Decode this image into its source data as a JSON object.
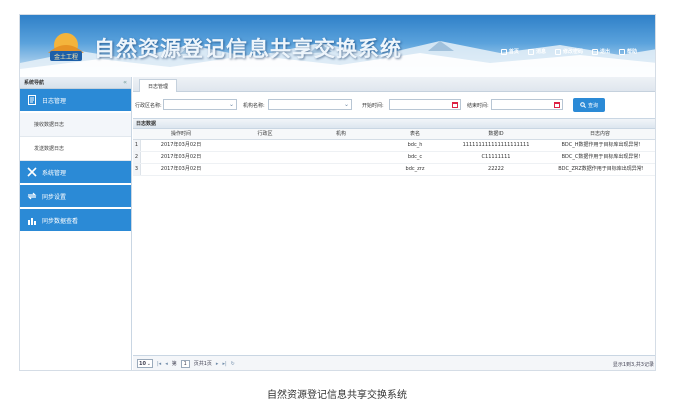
{
  "header": {
    "title": "自然资源登记信息共享交换系统",
    "logo_text": "金土工程",
    "nav": [
      "首页",
      "消息",
      "修改密码",
      "退出",
      "帮助"
    ]
  },
  "sidebar": {
    "title": "系统导航",
    "collapse_glyph": "«",
    "menus": [
      {
        "label": "日志管理",
        "icon": "log-icon"
      },
      {
        "label": "系统管理",
        "icon": "tools-icon"
      },
      {
        "label": "同步设置",
        "icon": "sync-icon"
      },
      {
        "label": "同步数据查看",
        "icon": "chart-icon"
      }
    ],
    "sub_items": [
      "接收数据日志",
      "发送数据日志"
    ]
  },
  "main": {
    "tab": "日志管理",
    "filters": {
      "region_label": "行政区名称:",
      "org_label": "机构名称:",
      "start_label": "开始时间:",
      "end_label": "结束时间:",
      "query_button": "查询"
    },
    "grid_title": "日志数据",
    "columns": [
      "操作时间",
      "行政区",
      "机构",
      "表名",
      "数据ID",
      "日志内容"
    ],
    "rows": [
      {
        "num": "1",
        "time": "2017年03月02日",
        "region": "",
        "org": "",
        "table": "bdc_h",
        "id": "111111111111111111111",
        "content": "BDC_H数据作用于目标库出现异常!"
      },
      {
        "num": "2",
        "time": "2017年03月02日",
        "region": "",
        "org": "",
        "table": "bdc_c",
        "id": "C11111111",
        "content": "BDC_C数据作用于目标库出现异常!"
      },
      {
        "num": "3",
        "time": "2017年03月02日",
        "region": "",
        "org": "",
        "table": "bdc_zrz",
        "id": "22222",
        "content": "BDC_ZRZ数据作用于目标库出现异常!"
      }
    ],
    "pager": {
      "page_size": "10",
      "page_prefix": "第",
      "page_value": "1",
      "page_suffix": "页共1页",
      "info": "显示1到3,共3记录"
    }
  },
  "caption": "自然资源登记信息共享交换系统",
  "colors": {
    "accent": "#2b8ad6",
    "header_top": "#2f80c8"
  }
}
